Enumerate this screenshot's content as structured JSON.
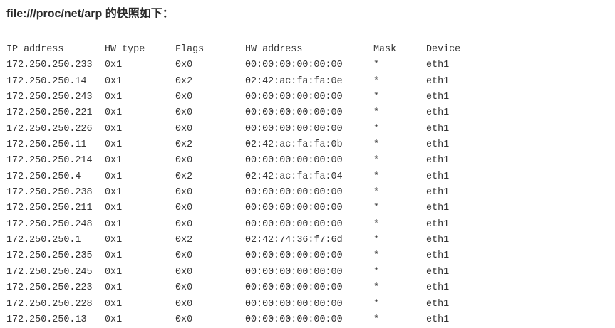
{
  "heading": "file:///proc/net/arp 的快照如下：",
  "table": {
    "headers": [
      "IP address",
      "HW type",
      "Flags",
      "HW address",
      "Mask",
      "Device"
    ],
    "rows": [
      [
        "172.250.250.233",
        "0x1",
        "0x0",
        "00:00:00:00:00:00",
        "*",
        "eth1"
      ],
      [
        "172.250.250.14",
        "0x1",
        "0x2",
        "02:42:ac:fa:fa:0e",
        "*",
        "eth1"
      ],
      [
        "172.250.250.243",
        "0x1",
        "0x0",
        "00:00:00:00:00:00",
        "*",
        "eth1"
      ],
      [
        "172.250.250.221",
        "0x1",
        "0x0",
        "00:00:00:00:00:00",
        "*",
        "eth1"
      ],
      [
        "172.250.250.226",
        "0x1",
        "0x0",
        "00:00:00:00:00:00",
        "*",
        "eth1"
      ],
      [
        "172.250.250.11",
        "0x1",
        "0x2",
        "02:42:ac:fa:fa:0b",
        "*",
        "eth1"
      ],
      [
        "172.250.250.214",
        "0x1",
        "0x0",
        "00:00:00:00:00:00",
        "*",
        "eth1"
      ],
      [
        "172.250.250.4",
        "0x1",
        "0x2",
        "02:42:ac:fa:fa:04",
        "*",
        "eth1"
      ],
      [
        "172.250.250.238",
        "0x1",
        "0x0",
        "00:00:00:00:00:00",
        "*",
        "eth1"
      ],
      [
        "172.250.250.211",
        "0x1",
        "0x0",
        "00:00:00:00:00:00",
        "*",
        "eth1"
      ],
      [
        "172.250.250.248",
        "0x1",
        "0x0",
        "00:00:00:00:00:00",
        "*",
        "eth1"
      ],
      [
        "172.250.250.1",
        "0x1",
        "0x2",
        "02:42:74:36:f7:6d",
        "*",
        "eth1"
      ],
      [
        "172.250.250.235",
        "0x1",
        "0x0",
        "00:00:00:00:00:00",
        "*",
        "eth1"
      ],
      [
        "172.250.250.245",
        "0x1",
        "0x0",
        "00:00:00:00:00:00",
        "*",
        "eth1"
      ],
      [
        "172.250.250.223",
        "0x1",
        "0x0",
        "00:00:00:00:00:00",
        "*",
        "eth1"
      ],
      [
        "172.250.250.228",
        "0x1",
        "0x0",
        "00:00:00:00:00:00",
        "*",
        "eth1"
      ],
      [
        "172.250.250.13",
        "0x1",
        "0x0",
        "00:00:00:00:00:00",
        "*",
        "eth1"
      ]
    ]
  }
}
